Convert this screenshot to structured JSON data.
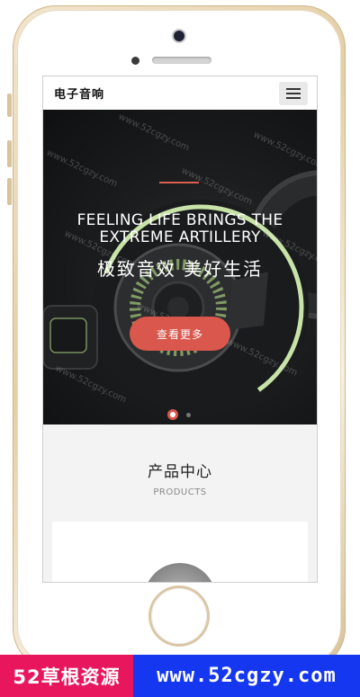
{
  "site": {
    "logo": "电子音响"
  },
  "hero": {
    "title_line1": "FEELING LIFE BRINGS THE",
    "title_line2": "EXTREME ARTILLERY",
    "subtitle": "极致音效  美好生活",
    "button": "查看更多",
    "slides": 2,
    "active_slide": 1,
    "watermark": "www.52cgzy.com",
    "accent_color": "#d9574d"
  },
  "products": {
    "title": "产品中心",
    "subtitle": "PRODUCTS"
  },
  "banner": {
    "left_text": "52草根资源",
    "right_text": "www.52cgzy.com",
    "left_color": "#e8175d",
    "right_color": "#1637f0"
  }
}
